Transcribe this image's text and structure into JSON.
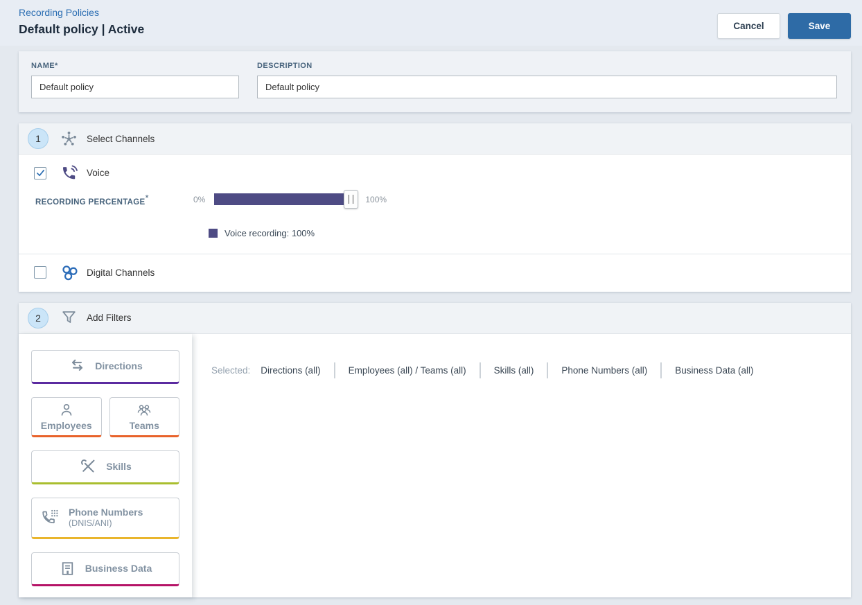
{
  "header": {
    "breadcrumb": "Recording Policies",
    "title": "Default policy | Active",
    "cancel_label": "Cancel",
    "save_label": "Save",
    "save_color": "#2e6ba6"
  },
  "form": {
    "name": {
      "label": "NAME*",
      "value": "Default policy"
    },
    "description": {
      "label": "DESCRIPTION",
      "value": "Default policy"
    }
  },
  "channels": {
    "step": "1",
    "title": "Select Channels",
    "voice": {
      "label": "Voice",
      "checked": true
    },
    "recording": {
      "label": "RECORDING PERCENTAGE",
      "required_mark": "*",
      "min_label": "0%",
      "max_label": "100%",
      "value_percent": 100,
      "fill_width": "100%",
      "bar_color": "#4e4b84",
      "legend": "Voice recording: 100%"
    },
    "digital": {
      "label": "Digital Channels",
      "checked": false
    }
  },
  "filters": {
    "step": "2",
    "title": "Add Filters",
    "buttons": {
      "directions": {
        "label": "Directions",
        "accent": "#5b2ba0"
      },
      "employees": {
        "label": "Employees",
        "accent": "#e8622a"
      },
      "teams": {
        "label": "Teams",
        "accent": "#e8622a"
      },
      "skills": {
        "label": "Skills",
        "accent": "#a9be2e"
      },
      "phone_numbers": {
        "label": "Phone Numbers",
        "sublabel": "(DNIS/ANI)",
        "accent": "#e9b52c"
      },
      "business_data": {
        "label": "Business Data",
        "accent": "#b51367"
      }
    },
    "selected": {
      "label": "Selected:",
      "items": [
        "Directions (all)",
        "Employees (all) / Teams (all)",
        "Skills (all)",
        "Phone Numbers (all)",
        "Business Data (all)"
      ]
    }
  }
}
